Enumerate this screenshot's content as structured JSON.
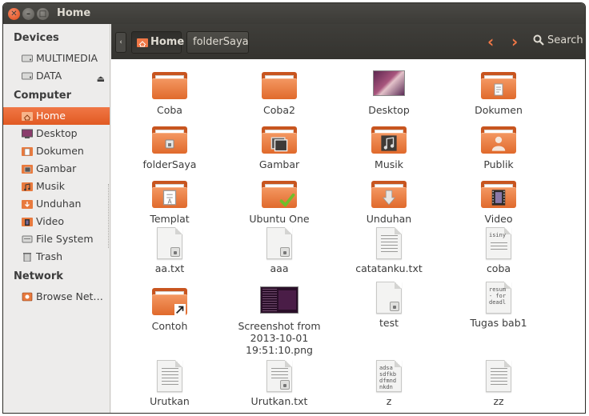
{
  "window": {
    "title": "Home",
    "controls": {
      "close": "✕",
      "minimize": "–",
      "maximize": "□"
    }
  },
  "sidebar": {
    "sections": [
      {
        "heading": "Devices",
        "items": [
          {
            "label": "MULTIMEDIA",
            "icon": "drive-icon"
          },
          {
            "label": "DATA",
            "icon": "drive-icon",
            "eject": "⏏"
          }
        ]
      },
      {
        "heading": "Computer",
        "items": [
          {
            "label": "Home",
            "icon": "home-folder-icon",
            "active": true
          },
          {
            "label": "Desktop",
            "icon": "desktop-icon"
          },
          {
            "label": "Dokumen",
            "icon": "documents-icon"
          },
          {
            "label": "Gambar",
            "icon": "pictures-icon"
          },
          {
            "label": "Musik",
            "icon": "music-icon"
          },
          {
            "label": "Unduhan",
            "icon": "downloads-icon"
          },
          {
            "label": "Video",
            "icon": "video-icon"
          },
          {
            "label": "File System",
            "icon": "filesystem-icon"
          },
          {
            "label": "Trash",
            "icon": "trash-icon"
          }
        ]
      },
      {
        "heading": "Network",
        "items": [
          {
            "label": "Browse Net…",
            "icon": "network-icon"
          }
        ]
      }
    ]
  },
  "toolbar": {
    "nav_left": "‹",
    "breadcrumbs": [
      "Home",
      "folderSaya"
    ],
    "back": "‹",
    "forward": "›",
    "search_label": "Search"
  },
  "files": [
    {
      "name": "Coba",
      "type": "folder"
    },
    {
      "name": "Coba2",
      "type": "folder"
    },
    {
      "name": "Desktop",
      "type": "desktop-thumbnail"
    },
    {
      "name": "Dokumen",
      "type": "folder",
      "emblem": "document"
    },
    {
      "name": "folderSaya",
      "type": "folder",
      "emblem": "lock"
    },
    {
      "name": "Gambar",
      "type": "folder",
      "emblem": "pictures"
    },
    {
      "name": "Musik",
      "type": "folder",
      "emblem": "music"
    },
    {
      "name": "Publik",
      "type": "folder",
      "emblem": "person"
    },
    {
      "name": "Templat",
      "type": "folder",
      "emblem": "template"
    },
    {
      "name": "Ubuntu One",
      "type": "folder",
      "emblem": "checkmark"
    },
    {
      "name": "Unduhan",
      "type": "folder",
      "emblem": "download"
    },
    {
      "name": "Video",
      "type": "folder",
      "emblem": "film"
    },
    {
      "name": "aa.txt",
      "type": "text-locked"
    },
    {
      "name": "aaa",
      "type": "text-locked"
    },
    {
      "name": "catatanku.txt",
      "type": "text"
    },
    {
      "name": "coba",
      "type": "text-preview",
      "preview": "isiny"
    },
    {
      "name": "Contoh",
      "type": "folder",
      "emblem": "link-arrow"
    },
    {
      "name": "Screenshot from 2013-10-01 19:51:10.png",
      "type": "image-thumbnail"
    },
    {
      "name": "test",
      "type": "text-locked"
    },
    {
      "name": "Tugas bab1",
      "type": "text-preview",
      "preview": "resum\n- for\ndeadl"
    },
    {
      "name": "Urutkan",
      "type": "text"
    },
    {
      "name": "Urutkan.txt",
      "type": "text-locked"
    },
    {
      "name": "z",
      "type": "text-preview",
      "preview": "adsa\nsdfkb\ndfmnd\nnkdn"
    },
    {
      "name": "zz",
      "type": "text"
    }
  ],
  "colors": {
    "accent": "#e15a22",
    "titlebar": "#3c3b37",
    "sidebar_bg": "#edeceb"
  }
}
